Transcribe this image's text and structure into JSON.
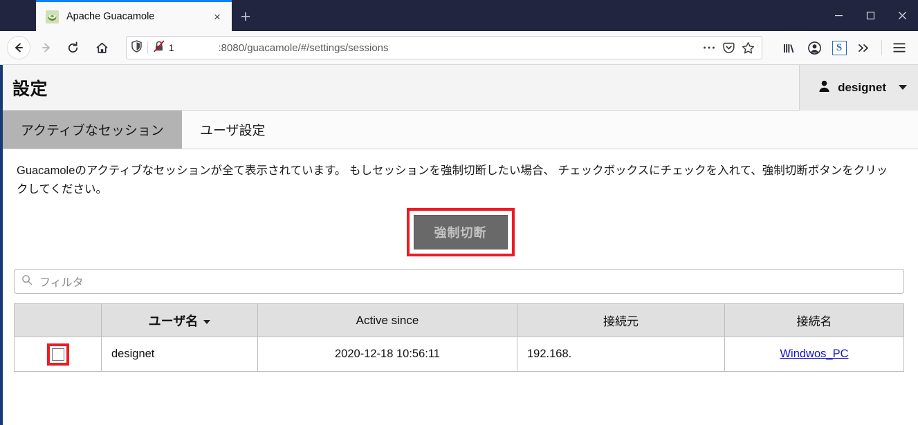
{
  "browser": {
    "tab": {
      "title": "Apache Guacamole",
      "favicon": "guacamole-favicon",
      "close_label": "×"
    },
    "newtab_label": "+",
    "window_controls": {
      "minimize": "—",
      "maximize": "□",
      "close": "✕"
    },
    "nav": {
      "back": "back-arrow",
      "forward": "forward-arrow",
      "reload": "reload-arrow",
      "home": "home-house"
    },
    "url": {
      "text": ":8080/guacamole/#/settings/sessions",
      "shield_icon": "shield",
      "insecure_icon": "crossed-lock",
      "tracker_count": "1",
      "page_actions": "•••",
      "pocket_icon": "pocket",
      "bookmark_icon": "star"
    },
    "toolbar_right": {
      "library": "library-books",
      "account": "account-circle",
      "extension": "S",
      "overflow": "»",
      "menu": "hamburger"
    }
  },
  "app": {
    "title": "設定",
    "user": {
      "name": "designet",
      "icon": "person-icon"
    },
    "tabs": [
      {
        "label": "アクティブなセッション",
        "active": true
      },
      {
        "label": "ユーザ設定",
        "active": false
      }
    ],
    "description": "Guacamoleのアクティブなセッションが全て表示されています。 もしセッションを強制切断したい場合、 チェックボックスにチェックを入れて、強制切断ボタンをクリックしてください。",
    "disconnect_button": {
      "label": "強制切断",
      "disabled": true
    },
    "filter": {
      "placeholder": "フィルタ",
      "value": "",
      "icon": "search-icon"
    },
    "table": {
      "columns": [
        {
          "label": "",
          "sorted": false
        },
        {
          "label": "ユーザ名",
          "sorted": true
        },
        {
          "label": "Active since",
          "sorted": false
        },
        {
          "label": "接続元",
          "sorted": false
        },
        {
          "label": "接続名",
          "sorted": false
        }
      ],
      "rows": [
        {
          "checked": false,
          "username": "designet",
          "active_since": "2020-12-18 10:56:11",
          "source": "192.168.",
          "connection": "Windwos_PC"
        }
      ]
    },
    "annotation_color": "#ee1b24"
  }
}
